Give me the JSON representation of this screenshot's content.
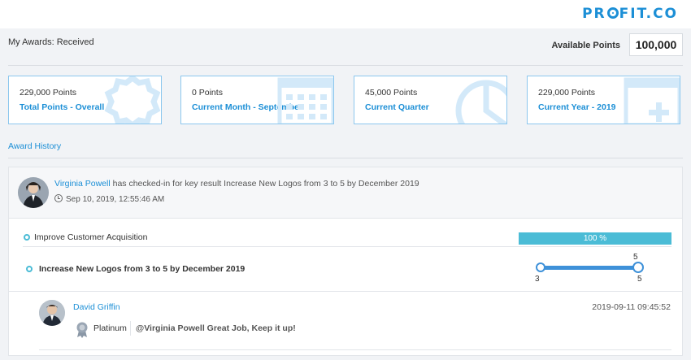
{
  "brand": {
    "logo_pre": "PR",
    "logo_post": "FIT.CO",
    "color": "#1c8fd6"
  },
  "header": {
    "title": "My Awards: Received",
    "points_label": "Available Points",
    "points_value": "100,000"
  },
  "cards": [
    {
      "value": "229,000 Points",
      "label": "Total Points - Overall",
      "icon": "badge-icon"
    },
    {
      "value": "0 Points",
      "label": "Current Month - September",
      "icon": "calendar-icon"
    },
    {
      "value": "45,000 Points",
      "label": "Current Quarter",
      "icon": "pie-chart-icon"
    },
    {
      "value": "229,000 Points",
      "label": "Current Year - 2019",
      "icon": "calendar-add-icon"
    }
  ],
  "history": {
    "link": "Award History",
    "entry": {
      "user": "Virginia Powell",
      "action": "has checked-in for key result Increase New Logos from 3 to 5 by December 2019",
      "timestamp": "Sep 10, 2019, 12:55:46 AM",
      "objective": "Improve Customer Acquisition",
      "progress": "100 %",
      "progress_fraction": 1.0,
      "key_result": "Increase New Logos from 3 to 5 by December 2019",
      "slider": {
        "start": "3",
        "current": "5",
        "target": "5"
      },
      "comment": {
        "author": "David Griffin",
        "date": "2019-09-11 09:45:52",
        "badge": "Platinum",
        "text": "@Virginia Powell Great Job, Keep it up!"
      }
    }
  }
}
